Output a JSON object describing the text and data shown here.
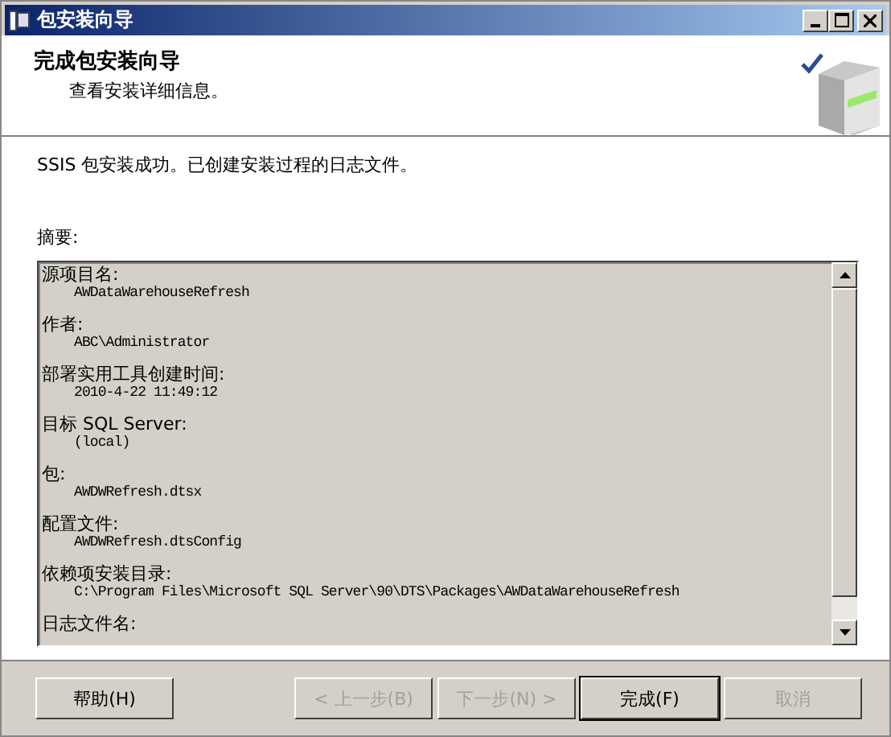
{
  "window": {
    "title": "包安装向导"
  },
  "header": {
    "title": "完成包安装向导",
    "subtitle": "查看安装详细信息。"
  },
  "message": "SSIS 包安装成功。已创建安装过程的日志文件。",
  "summary": {
    "label": "摘要:",
    "entries": [
      {
        "label": "源项目名:",
        "value": "AWDataWarehouseRefresh"
      },
      {
        "label": "作者:",
        "value": "ABC\\Administrator"
      },
      {
        "label": "部署实用工具创建时间:",
        "value": "2010-4-22 11:49:12"
      },
      {
        "label": "目标 SQL Server:",
        "value": "(local)"
      },
      {
        "label": "包:",
        "value": "AWDWRefresh.dtsx"
      },
      {
        "label": "配置文件:",
        "value": "AWDWRefresh.dtsConfig"
      },
      {
        "label": "依赖项安装目录:",
        "value": "C:\\Program Files\\Microsoft SQL Server\\90\\DTS\\Packages\\AWDataWarehouseRefresh"
      },
      {
        "label": "日志文件名:"
      }
    ]
  },
  "buttons": [
    {
      "label": "帮助(H)",
      "disabled": false,
      "default": false
    },
    {
      "label": "< 上一步(B)",
      "disabled": true,
      "default": false
    },
    {
      "label": "下一步(N) >",
      "disabled": true,
      "default": false
    },
    {
      "label": "完成(F)",
      "disabled": false,
      "default": true
    },
    {
      "label": "取消",
      "disabled": true,
      "default": false
    }
  ]
}
